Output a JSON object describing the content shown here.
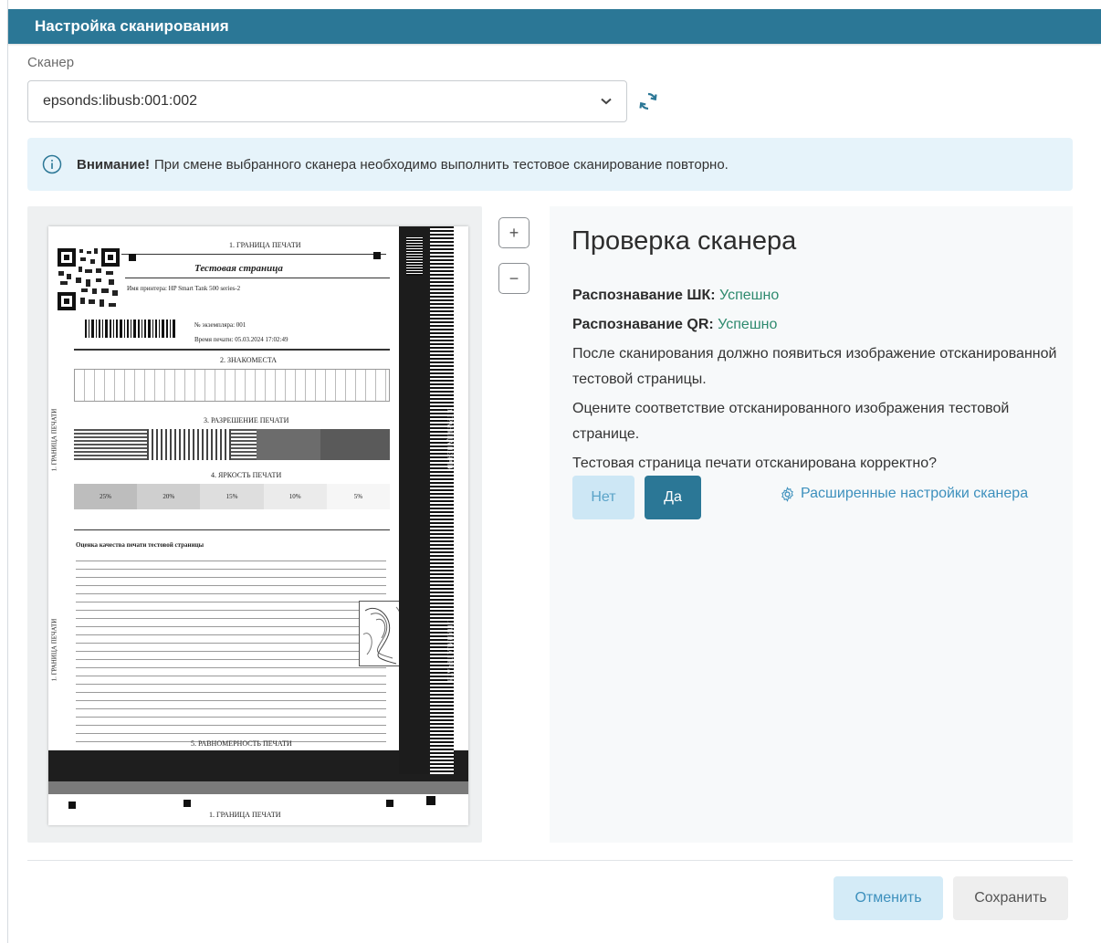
{
  "dialog": {
    "title": "Настройка сканирования"
  },
  "scanner": {
    "label": "Сканер",
    "selected": "epsonds:libusb:001:002"
  },
  "alert": {
    "strong": "Внимание!",
    "text": "При смене выбранного сканера необходимо выполнить тестовое сканирование повторно."
  },
  "preview": {
    "zoom_in": "+",
    "zoom_out": "−",
    "page": {
      "top_border": "1. ГРАНИЦА ПЕЧАТИ",
      "title": "Тестовая страница",
      "printer_name": "Имя принтера: HP Smart Tank 500 series-2",
      "copy_no": "№ экземпляра: 001",
      "print_time": "Время печати: 05.03.2024 17:02:49",
      "sec2": "2. ЗНАКОМЕСТА",
      "sec3": "3. РАЗРЕШЕНИЕ ПЕЧАТИ",
      "sec4": "4. ЯРКОСТЬ ПЕЧАТИ",
      "brightness": [
        "25%",
        "20%",
        "15%",
        "10%",
        "5%"
      ],
      "side_label": "1. ГРАНИЦА ПЕЧАТИ",
      "sec5": "5. РАВНОМЕРНОСТЬ ПЕЧАТИ",
      "bottom_border": "1. ГРАНИЦА ПЕЧАТИ",
      "instructions_title": "Оценка качества печати тестовой страницы"
    }
  },
  "check": {
    "title": "Проверка сканера",
    "barcode_label": "Распознавание ШК:",
    "barcode_status": "Успешно",
    "qr_label": "Распознавание QR:",
    "qr_status": "Успешно",
    "p1": "После сканирования должно появиться изображение отсканированной тестовой страницы.",
    "p2": "Оцените соответствие отсканированного изображения тестовой странице.",
    "question": "Тестовая страница печати отсканирована корректно?",
    "no_label": "Нет",
    "yes_label": "Да",
    "advanced_label": "Расширенные настройки сканера"
  },
  "footer": {
    "cancel_label": "Отменить",
    "save_label": "Сохранить"
  },
  "colors": {
    "header": "#2b7796",
    "alert_bg": "#e6f3fa",
    "success": "#2e8a6e",
    "link": "#3d90bd"
  }
}
